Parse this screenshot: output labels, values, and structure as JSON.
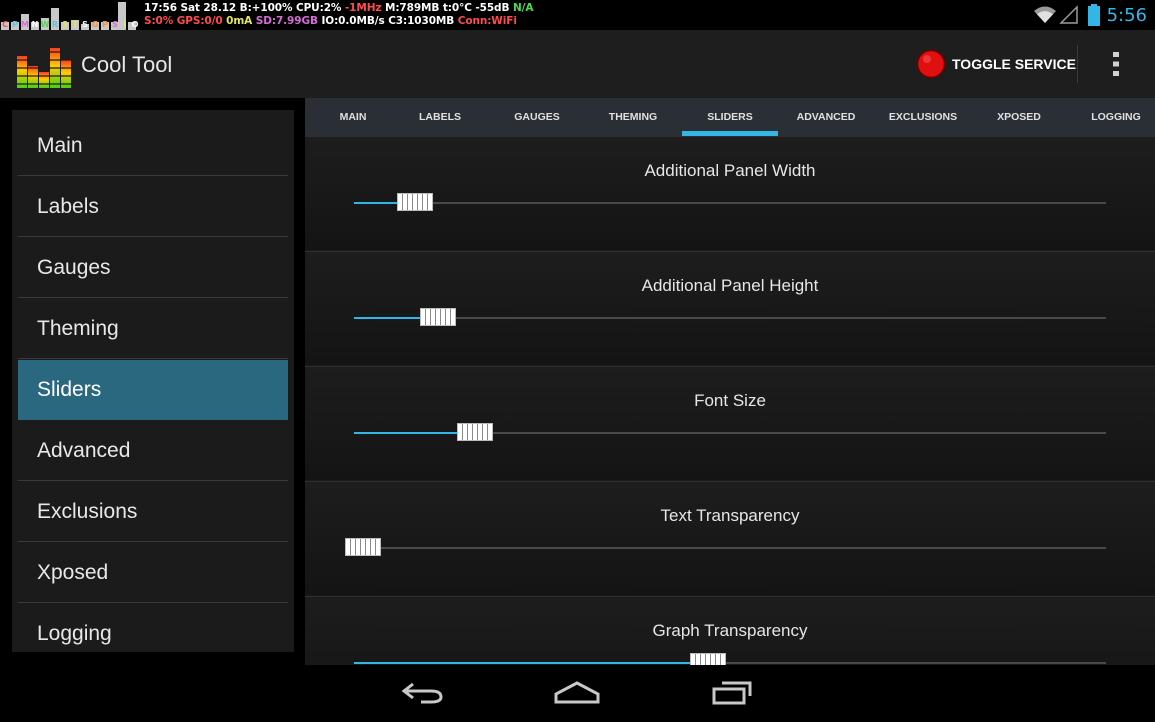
{
  "status_bar": {
    "mini_graph_labels": [
      "C",
      "P",
      "M",
      "N",
      "W",
      "R",
      "S",
      "T",
      "S",
      "G",
      "P",
      "S",
      "I",
      "O"
    ],
    "line1": [
      {
        "text": "17:56 Sat 28.12 ",
        "color": "white"
      },
      {
        "text": "B:+100% ",
        "color": "white"
      },
      {
        "text": "CPU:2% ",
        "color": "white"
      },
      {
        "text": "-1MHz ",
        "color": "red"
      },
      {
        "text": "M:789MB ",
        "color": "white"
      },
      {
        "text": "t:0°C ",
        "color": "white"
      },
      {
        "text": "-55dB ",
        "color": "white"
      },
      {
        "text": "N/A",
        "color": "green"
      }
    ],
    "line2": [
      {
        "text": "S:0% ",
        "color": "red"
      },
      {
        "text": "GPS:0/0 ",
        "color": "red"
      },
      {
        "text": "0mA ",
        "color": "yellow"
      },
      {
        "text": "SD:7.99GB ",
        "color": "magenta"
      },
      {
        "text": "IO:0.0MB/s ",
        "color": "white"
      },
      {
        "text": "C3:1030MB ",
        "color": "white"
      },
      {
        "text": "Conn:WiFi",
        "color": "red"
      }
    ],
    "clock": "5:56",
    "icons": [
      "wifi-icon",
      "signal-icon",
      "battery-icon"
    ]
  },
  "action_bar": {
    "title": "Cool Tool",
    "toggle_label": "TOGGLE SERVICE",
    "icons": [
      "app-logo-icon",
      "record-icon",
      "overflow-menu-icon"
    ]
  },
  "sidebar": {
    "items": [
      {
        "label": "Main",
        "active": false
      },
      {
        "label": "Labels",
        "active": false
      },
      {
        "label": "Gauges",
        "active": false
      },
      {
        "label": "Theming",
        "active": false
      },
      {
        "label": "Sliders",
        "active": true
      },
      {
        "label": "Advanced",
        "active": false
      },
      {
        "label": "Exclusions",
        "active": false
      },
      {
        "label": "Xposed",
        "active": false
      },
      {
        "label": "Logging",
        "active": false
      }
    ]
  },
  "tabs": [
    {
      "label": "MAIN",
      "active": false
    },
    {
      "label": "LABELS",
      "active": false
    },
    {
      "label": "GAUGES",
      "active": false
    },
    {
      "label": "THEMING",
      "active": false
    },
    {
      "label": "SLIDERS",
      "active": true
    },
    {
      "label": "ADVANCED",
      "active": false
    },
    {
      "label": "EXCLUSIONS",
      "active": false
    },
    {
      "label": "XPOSED",
      "active": false
    },
    {
      "label": "LOGGING",
      "active": false
    }
  ],
  "sliders": [
    {
      "title": "Additional Panel Width",
      "value": 0.08
    },
    {
      "title": "Additional Panel Height",
      "value": 0.11
    },
    {
      "title": "Font Size",
      "value": 0.16
    },
    {
      "title": "Text Transparency",
      "value": 0.0
    },
    {
      "title": "Graph Transparency",
      "value": 0.47
    }
  ],
  "colors": {
    "accent": "#33b5e5",
    "active_sidebar": "#2a6880",
    "record_button": "#e01010"
  },
  "nav_bar": {
    "icons": [
      "back-icon",
      "home-icon",
      "recent-apps-icon"
    ]
  }
}
